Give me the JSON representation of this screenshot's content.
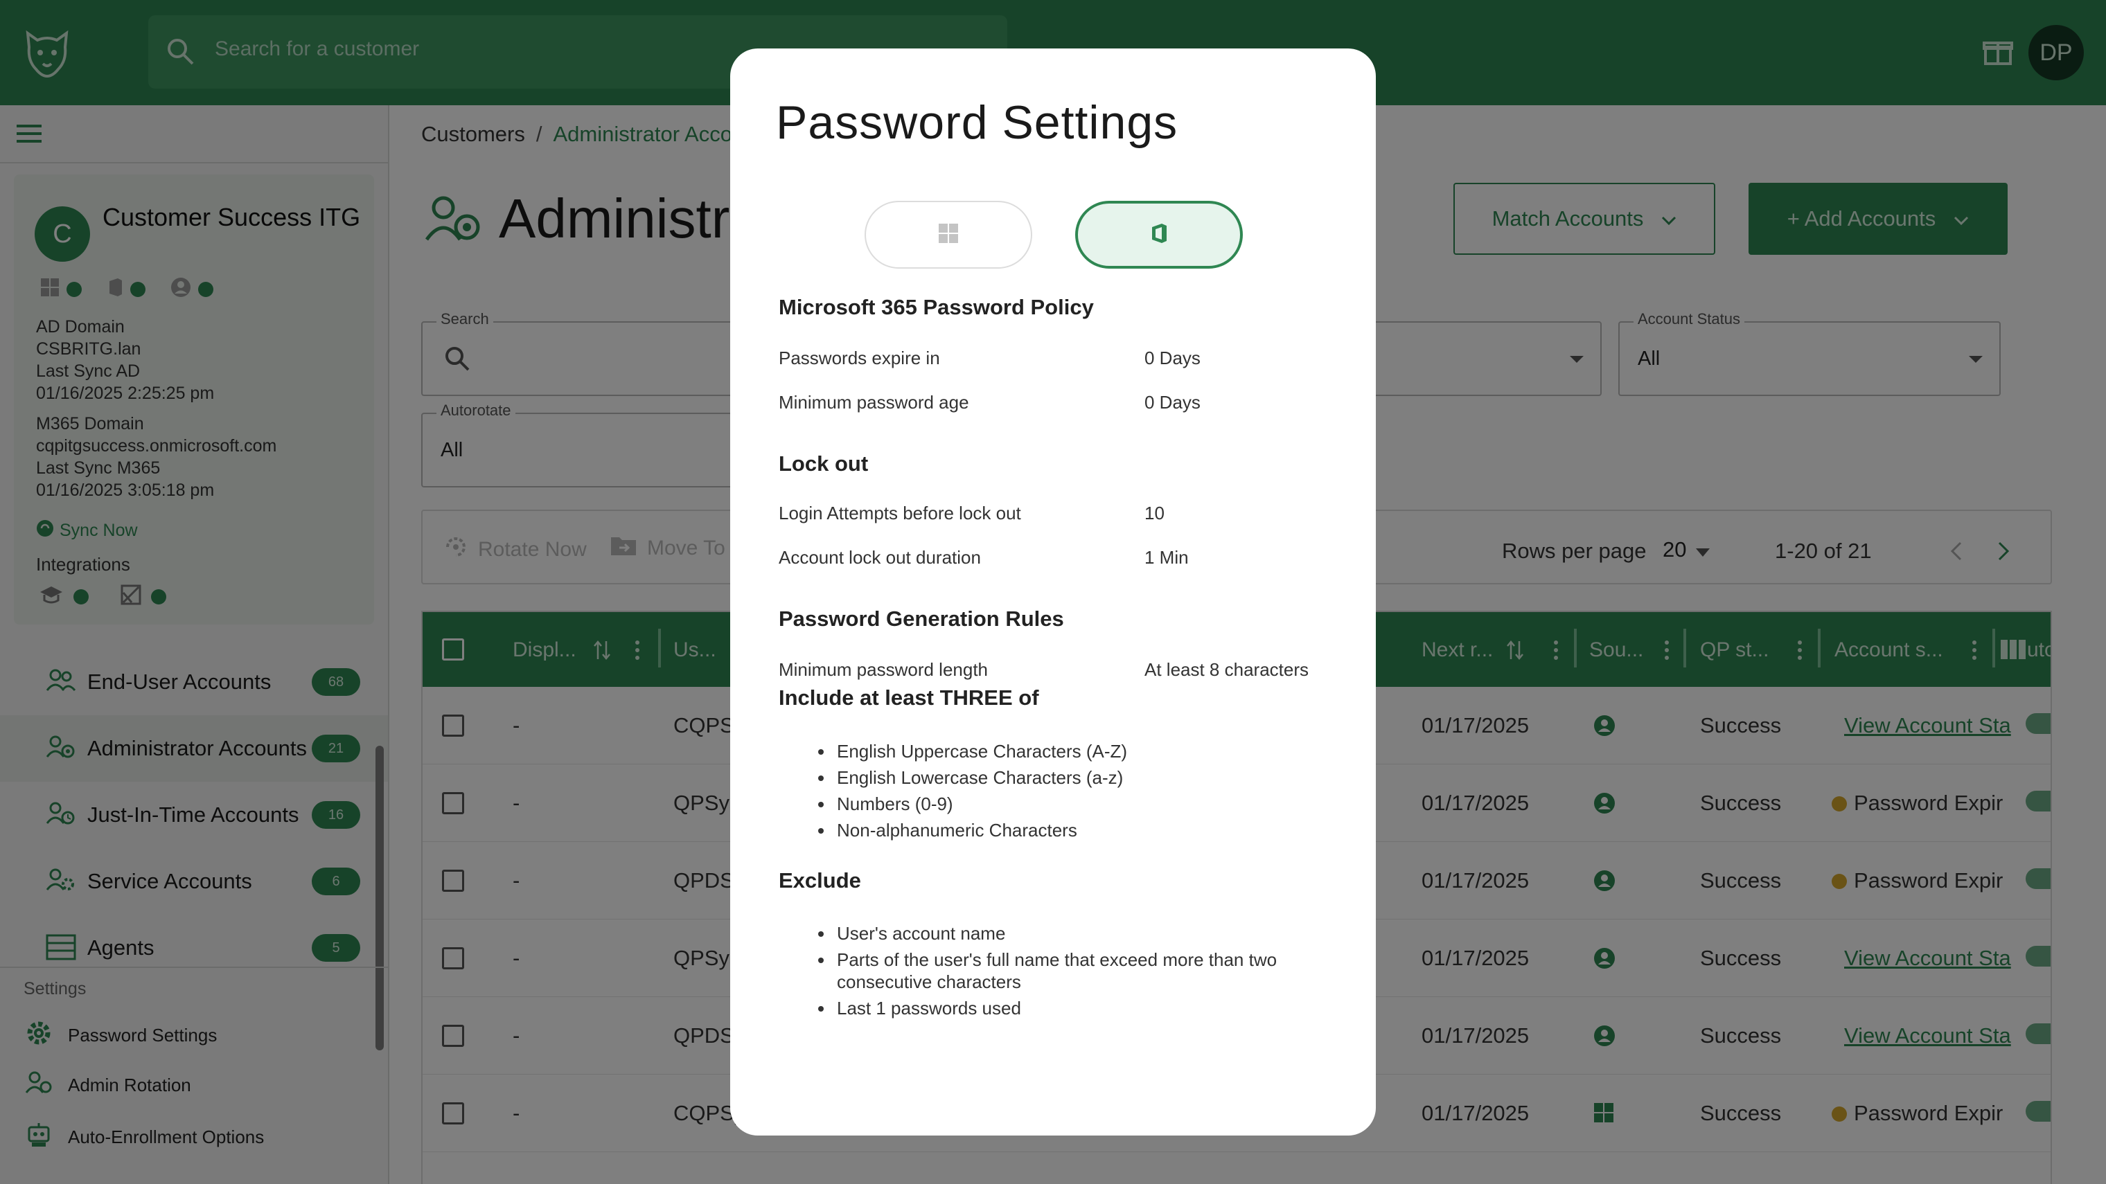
{
  "topbar": {
    "search_placeholder": "Search for a customer",
    "user_initials": "DP"
  },
  "customer": {
    "initial": "C",
    "name": "Customer Success ITG",
    "ad_domain_label": "AD Domain",
    "ad_domain": "CSBRITG.lan",
    "last_sync_ad_label": "Last Sync AD",
    "last_sync_ad": "01/16/2025 2:25:25 pm",
    "m365_domain_label": "M365 Domain",
    "m365_domain": "cqpitgsuccess.onmicrosoft.com",
    "last_sync_m365_label": "Last Sync M365",
    "last_sync_m365": "01/16/2025 3:05:18 pm",
    "sync_now": "Sync Now",
    "integrations_label": "Integrations"
  },
  "nav": {
    "items": [
      {
        "label": "End-User Accounts",
        "count": "68"
      },
      {
        "label": "Administrator Accounts",
        "count": "21"
      },
      {
        "label": "Just-In-Time Accounts",
        "count": "16"
      },
      {
        "label": "Service Accounts",
        "count": "6"
      },
      {
        "label": "Agents",
        "count": "5"
      }
    ]
  },
  "settings": {
    "header": "Settings",
    "items": [
      "Password Settings",
      "Admin Rotation",
      "Auto-Enrollment Options"
    ]
  },
  "breadcrumb": {
    "root": "Customers",
    "sep": "/",
    "current": "Administrator Acco"
  },
  "page": {
    "title": "Administr",
    "match_button": "Match Accounts",
    "add_button": "+ Add Accounts"
  },
  "filters": {
    "search_label": "Search",
    "autorotate_label": "Autorotate",
    "autorotate_value": "All",
    "account_status_label": "Account Status",
    "account_status_value": "All"
  },
  "toolbar": {
    "rotate_now": "Rotate Now",
    "move_to": "Move To",
    "rows_per_page_label": "Rows per page",
    "rows_per_page_value": "20",
    "pagination": "1-20 of 21"
  },
  "table": {
    "headers": {
      "display": "Displ...",
      "username": "Us...",
      "next_rotation": "Next r...",
      "source": "Sou...",
      "qp_status": "QP st...",
      "account_status": "Account s...",
      "auto": "uto"
    },
    "rows": [
      {
        "display": "-",
        "user": "CQPSy",
        "next": "01/17/2025",
        "source": "person",
        "qp": "Success",
        "status": "View Account Sta",
        "status_type": "link"
      },
      {
        "display": "-",
        "user": "QPSys",
        "next": "01/17/2025",
        "source": "person",
        "qp": "Success",
        "status": "Password Expir",
        "status_type": "warn"
      },
      {
        "display": "-",
        "user": "QPDSy",
        "next": "01/17/2025",
        "source": "person",
        "qp": "Success",
        "status": "Password Expir",
        "status_type": "warn"
      },
      {
        "display": "-",
        "user": "QPSys",
        "next": "01/17/2025",
        "source": "person",
        "qp": "Success",
        "status": "View Account Sta",
        "status_type": "link"
      },
      {
        "display": "-",
        "user": "QPDSy",
        "next": "01/17/2025",
        "source": "person",
        "qp": "Success",
        "status": "View Account Sta",
        "status_type": "link"
      },
      {
        "display": "-",
        "user": "CQPSy",
        "next": "01/17/2025",
        "source": "windows",
        "qp": "Success",
        "status": "Password Expir",
        "status_type": "warn"
      }
    ]
  },
  "modal": {
    "title": "Password Settings",
    "policy_heading": "Microsoft 365 Password Policy",
    "expire_label": "Passwords expire in",
    "expire_value": "0 Days",
    "min_age_label": "Minimum password age",
    "min_age_value": "0 Days",
    "lockout_heading": "Lock out",
    "attempts_label": "Login Attempts before lock out",
    "attempts_value": "10",
    "duration_label": "Account lock out duration",
    "duration_value": "1 Min",
    "gen_heading": "Password Generation Rules",
    "min_len_label": "Minimum password length",
    "min_len_value": "At least 8 characters",
    "include_heading": "Include at least THREE of",
    "include_items": [
      "English Uppercase Characters (A-Z)",
      "English Lowercase Characters (a-z)",
      "Numbers (0-9)",
      "Non-alphanumeric Characters"
    ],
    "exclude_heading": "Exclude",
    "exclude_items": [
      "User's account name",
      "Parts of the user's full name that exceed more than two consecutive characters",
      "Last 1 passwords used"
    ]
  },
  "colors": {
    "brand_green": "#2f8752",
    "warning_yellow": "#d4a72c"
  }
}
